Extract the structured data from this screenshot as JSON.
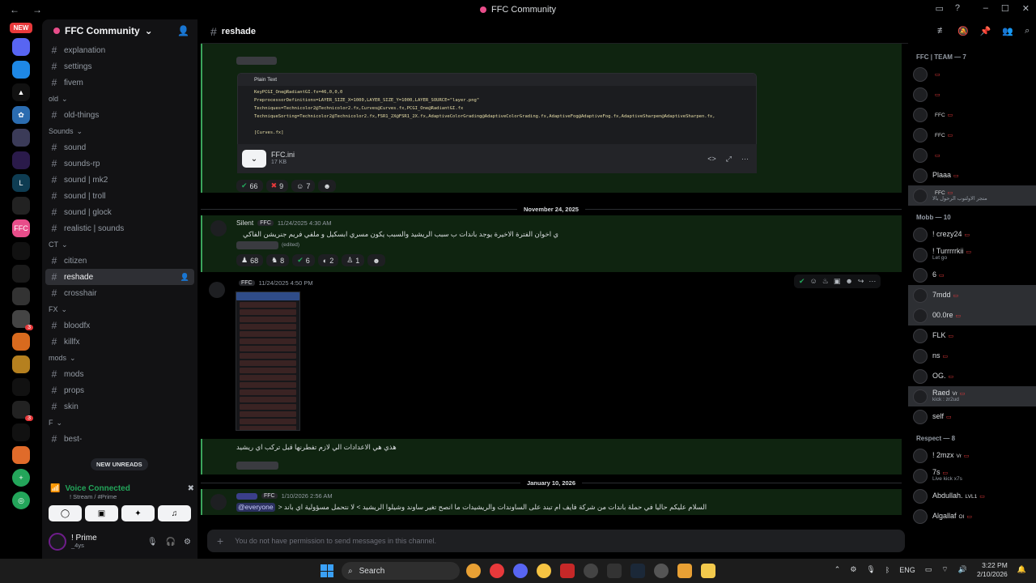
{
  "window": {
    "title": "FFC Community"
  },
  "rail": {
    "new_badge": "NEW",
    "badges": [
      "3",
      "3"
    ]
  },
  "sidebar": {
    "server_name": "FFC Community",
    "items": [
      {
        "kind": "ch",
        "label": "explanation"
      },
      {
        "kind": "ch",
        "label": "settings"
      },
      {
        "kind": "ch",
        "label": "fivem"
      },
      {
        "kind": "cat",
        "label": "old"
      },
      {
        "kind": "ch",
        "label": "old-things"
      },
      {
        "kind": "cat",
        "label": "Sounds"
      },
      {
        "kind": "ch",
        "label": "sound"
      },
      {
        "kind": "ch",
        "label": "sounds-rp"
      },
      {
        "kind": "ch",
        "label": "sound | mk2"
      },
      {
        "kind": "ch",
        "label": "sound | troll"
      },
      {
        "kind": "ch",
        "label": "sound | glock"
      },
      {
        "kind": "ch",
        "label": "realistic | sounds"
      },
      {
        "kind": "cat",
        "label": "CT"
      },
      {
        "kind": "ch",
        "label": "citizen"
      },
      {
        "kind": "ch",
        "label": "reshade",
        "active": true
      },
      {
        "kind": "ch",
        "label": "crosshair"
      },
      {
        "kind": "cat",
        "label": "FX"
      },
      {
        "kind": "ch",
        "label": "bloodfx"
      },
      {
        "kind": "ch",
        "label": "killfx"
      },
      {
        "kind": "cat",
        "label": "mods"
      },
      {
        "kind": "ch",
        "label": "mods"
      },
      {
        "kind": "ch",
        "label": "props"
      },
      {
        "kind": "ch",
        "label": "skin"
      },
      {
        "kind": "cat",
        "label": "F"
      },
      {
        "kind": "ch",
        "label": "best-"
      }
    ],
    "new_unreads": "NEW UNREADS"
  },
  "voice": {
    "status": "Voice Connected",
    "location": "! Stream / #Prime"
  },
  "user": {
    "name": "! Prime",
    "status": "_4ys"
  },
  "channel": {
    "name": "reshade"
  },
  "code": {
    "lang": "Plain Text",
    "lines": [
      "KeyPCGI_One@RadiantGI.fx=46,0,0,0",
      "PreprocessorDefinitions=LAYER_SIZE_X=1000,LAYER_SIZE_Y=1000,LAYER_SOURCE=\"layer.png\"",
      "Techniques=Technicolor2@Technicolor2.fx,Curves@Curves.fx,PCGI_One@RadiantGI.fx",
      "TechniqueSorting=Technicolor2@Technicolor2.fx,FSR1_2X@FSR1_2X.fx,AdaptiveColorGrading@AdaptiveColorGrading.fx,AdaptiveFog@AdaptiveFog.fx,AdaptiveSharpen@AdaptiveSharpen.fx,",
      "",
      "[Curves.fx]"
    ],
    "file_name": "FFC.ini",
    "file_size": "17 KB"
  },
  "reactions1": [
    "66",
    "9",
    "7"
  ],
  "date1": "November 24, 2025",
  "msg1": {
    "author": "Silent",
    "tag": "FFC",
    "time": "11/24/2025 4:30 AM",
    "text": "ي اخوان الفترة الاخيرة يوجد باندات ب سبب الريشيد والسبب يكون مسري  ابسكيل و ملفي فريم جنريشن الفاكي",
    "edited": "(edited)",
    "reactions": [
      "68",
      "8",
      "6",
      "2",
      "1"
    ]
  },
  "msg2": {
    "author": "",
    "tag": "FFC",
    "time": "11/24/2025 4:50 PM",
    "text": "هذي هي الاعدادات الي لازم تفطرنها قبل تركب اي ريشيد"
  },
  "date2": "January 10, 2026",
  "msg3": {
    "tag": "FFC",
    "time": "1/10/2026 2:56 AM",
    "mention": "@everyone",
    "text": "السلام عليكم حاليا في حملة باندات من شركة فايف ام تبند على الساوندات والريشيدات ما انصح تغير ساوند وشيلوا الريشيد > لا نتحمل مسؤولية اي باند <"
  },
  "composer": {
    "placeholder": "You do not have permission to send messages in this channel."
  },
  "members": {
    "groups": [
      {
        "title": "FFC | TEAM — 7",
        "items": [
          {
            "name": ""
          },
          {
            "name": ""
          },
          {
            "name": "",
            "tag": "FFC"
          },
          {
            "name": "",
            "tag": "FFC"
          },
          {
            "name": ""
          },
          {
            "name": "Plaaa"
          },
          {
            "name": "",
            "tag": "FFC",
            "sub": "متجر الاولتوب الرحول بالا",
            "hl": true
          }
        ]
      },
      {
        "title": "Mobb — 10",
        "items": [
          {
            "name": "! crezy24"
          },
          {
            "name": "! Turrrrrkii",
            "sub": "Let go"
          },
          {
            "name": "6"
          },
          {
            "name": "7mdd",
            "hl": true
          },
          {
            "name": "00.0re",
            "hl": true
          },
          {
            "name": "FLK"
          },
          {
            "name": "ns"
          },
          {
            "name": "OG."
          },
          {
            "name": "Raed",
            "tag": "Vr",
            "sub": "kick : zr2ud",
            "hl": true
          },
          {
            "name": "self"
          }
        ]
      },
      {
        "title": "Respect — 8",
        "items": [
          {
            "name": "! 2mzx",
            "tag": "Vr"
          },
          {
            "name": "7s",
            "sub": "Live kick x7s"
          },
          {
            "name": "Abdullah.",
            "tag": "LVL1"
          },
          {
            "name": "Algallaf",
            "tag": "OI"
          }
        ]
      }
    ]
  },
  "taskbar": {
    "search": "Search",
    "lang": "ENG",
    "time": "3:22 PM",
    "date": "2/10/2026"
  }
}
